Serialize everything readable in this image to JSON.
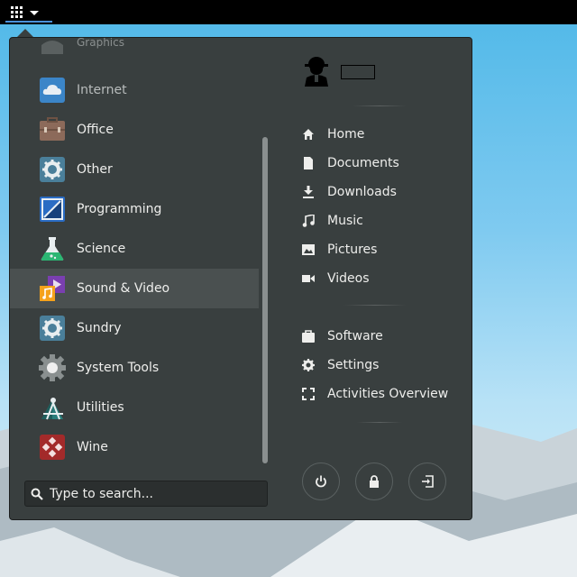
{
  "topbar": {
    "apps_icon": "apps-grid-icon",
    "dropdown_icon": "chevron-down-icon"
  },
  "categories": [
    {
      "label": "Graphics",
      "icon": "graphics-icon"
    },
    {
      "label": "Internet",
      "icon": "internet-cloud-icon"
    },
    {
      "label": "Office",
      "icon": "office-briefcase-icon"
    },
    {
      "label": "Other",
      "icon": "gear-icon"
    },
    {
      "label": "Programming",
      "icon": "programming-icon"
    },
    {
      "label": "Science",
      "icon": "science-flask-icon"
    },
    {
      "label": "Sound & Video",
      "icon": "multimedia-icon",
      "active": true
    },
    {
      "label": "Sundry",
      "icon": "gear-icon"
    },
    {
      "label": "System Tools",
      "icon": "system-tools-icon"
    },
    {
      "label": "Utilities",
      "icon": "utilities-icon"
    },
    {
      "label": "Wine",
      "icon": "wine-icon"
    }
  ],
  "search": {
    "placeholder": "Type to search...",
    "value": "",
    "icon": "search-icon"
  },
  "user": {
    "avatar_icon": "user-avatar-icon"
  },
  "places": [
    {
      "label": "Home",
      "icon": "home-icon"
    },
    {
      "label": "Documents",
      "icon": "document-icon"
    },
    {
      "label": "Downloads",
      "icon": "download-icon"
    },
    {
      "label": "Music",
      "icon": "music-icon"
    },
    {
      "label": "Pictures",
      "icon": "picture-icon"
    },
    {
      "label": "Videos",
      "icon": "video-camera-icon"
    }
  ],
  "system": [
    {
      "label": "Software",
      "icon": "software-bag-icon"
    },
    {
      "label": "Settings",
      "icon": "gear-icon"
    },
    {
      "label": "Activities Overview",
      "icon": "activities-overview-icon"
    }
  ],
  "session_buttons": [
    {
      "name": "power-button",
      "icon": "power-icon"
    },
    {
      "name": "lock-button",
      "icon": "lock-icon"
    },
    {
      "name": "logout-button",
      "icon": "logout-icon"
    }
  ],
  "colors": {
    "menu_bg": "#393f3f",
    "active_bg": "#4a5050",
    "text": "#eeeeec",
    "accent": "#4a90d9"
  }
}
